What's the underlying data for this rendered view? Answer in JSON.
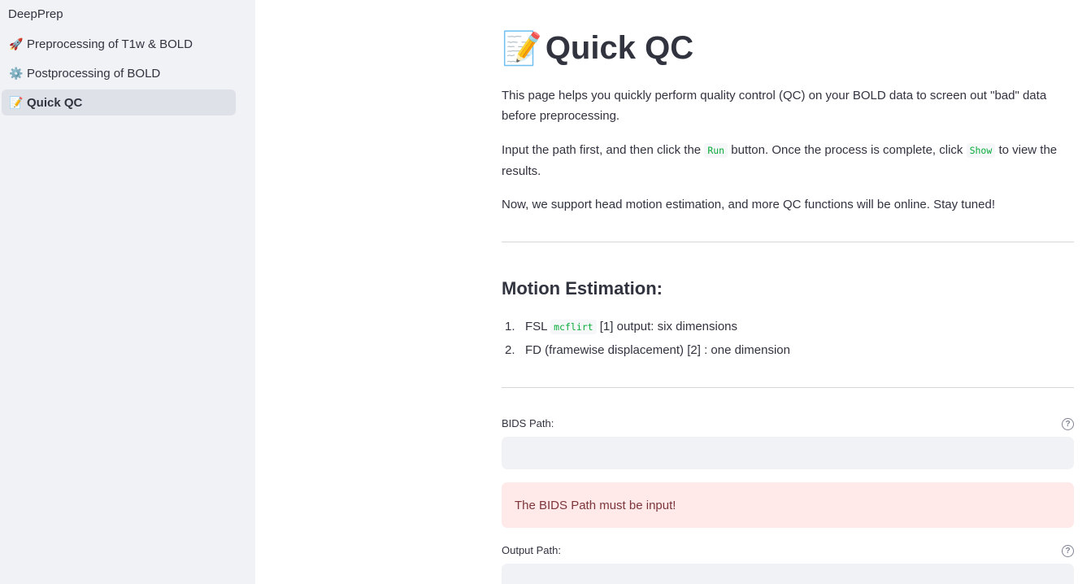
{
  "sidebar": {
    "app_title": "DeepPrep",
    "items": [
      {
        "icon": "rocket-icon",
        "emoji": "🚀",
        "label": "Preprocessing of T1w & BOLD"
      },
      {
        "icon": "gear-icon",
        "emoji": "⚙️",
        "label": "Postprocessing of BOLD"
      },
      {
        "icon": "memo-icon",
        "emoji": "📝",
        "label": "Quick QC"
      }
    ]
  },
  "main": {
    "title_emoji": "📝",
    "title": "Quick QC",
    "intro": "This page helps you quickly perform quality control (QC) on your BOLD data to screen out \"bad\" data before preprocessing.",
    "instruction": {
      "part1": "Input the path first, and then click the ",
      "code1": "Run",
      "part2": " button. Once the process is complete, click ",
      "code2": "Show",
      "part3": " to view the results."
    },
    "support": "Now, we support head motion estimation, and more QC functions will be online. Stay tuned!",
    "section_title": "Motion Estimation:",
    "list": [
      {
        "num": "1.",
        "pre": "FSL ",
        "code": "mcflirt",
        "post": " [1] output: six dimensions"
      },
      {
        "num": "2.",
        "text": "FD (framewise displacement) [2] : one dimension"
      }
    ],
    "bids_label": "BIDS Path:",
    "bids_value": "",
    "bids_error": "The BIDS Path must be input!",
    "output_label": "Output Path:",
    "output_value": "",
    "help_glyph": "?"
  },
  "colors": {
    "sidebar_bg": "#f0f2f6",
    "active_item_bg": "#dfe1e8",
    "code_text": "#09ab3b",
    "alert_bg": "#ffe9e9",
    "alert_text": "#7d353b",
    "input_bg": "#f0f2f6"
  }
}
